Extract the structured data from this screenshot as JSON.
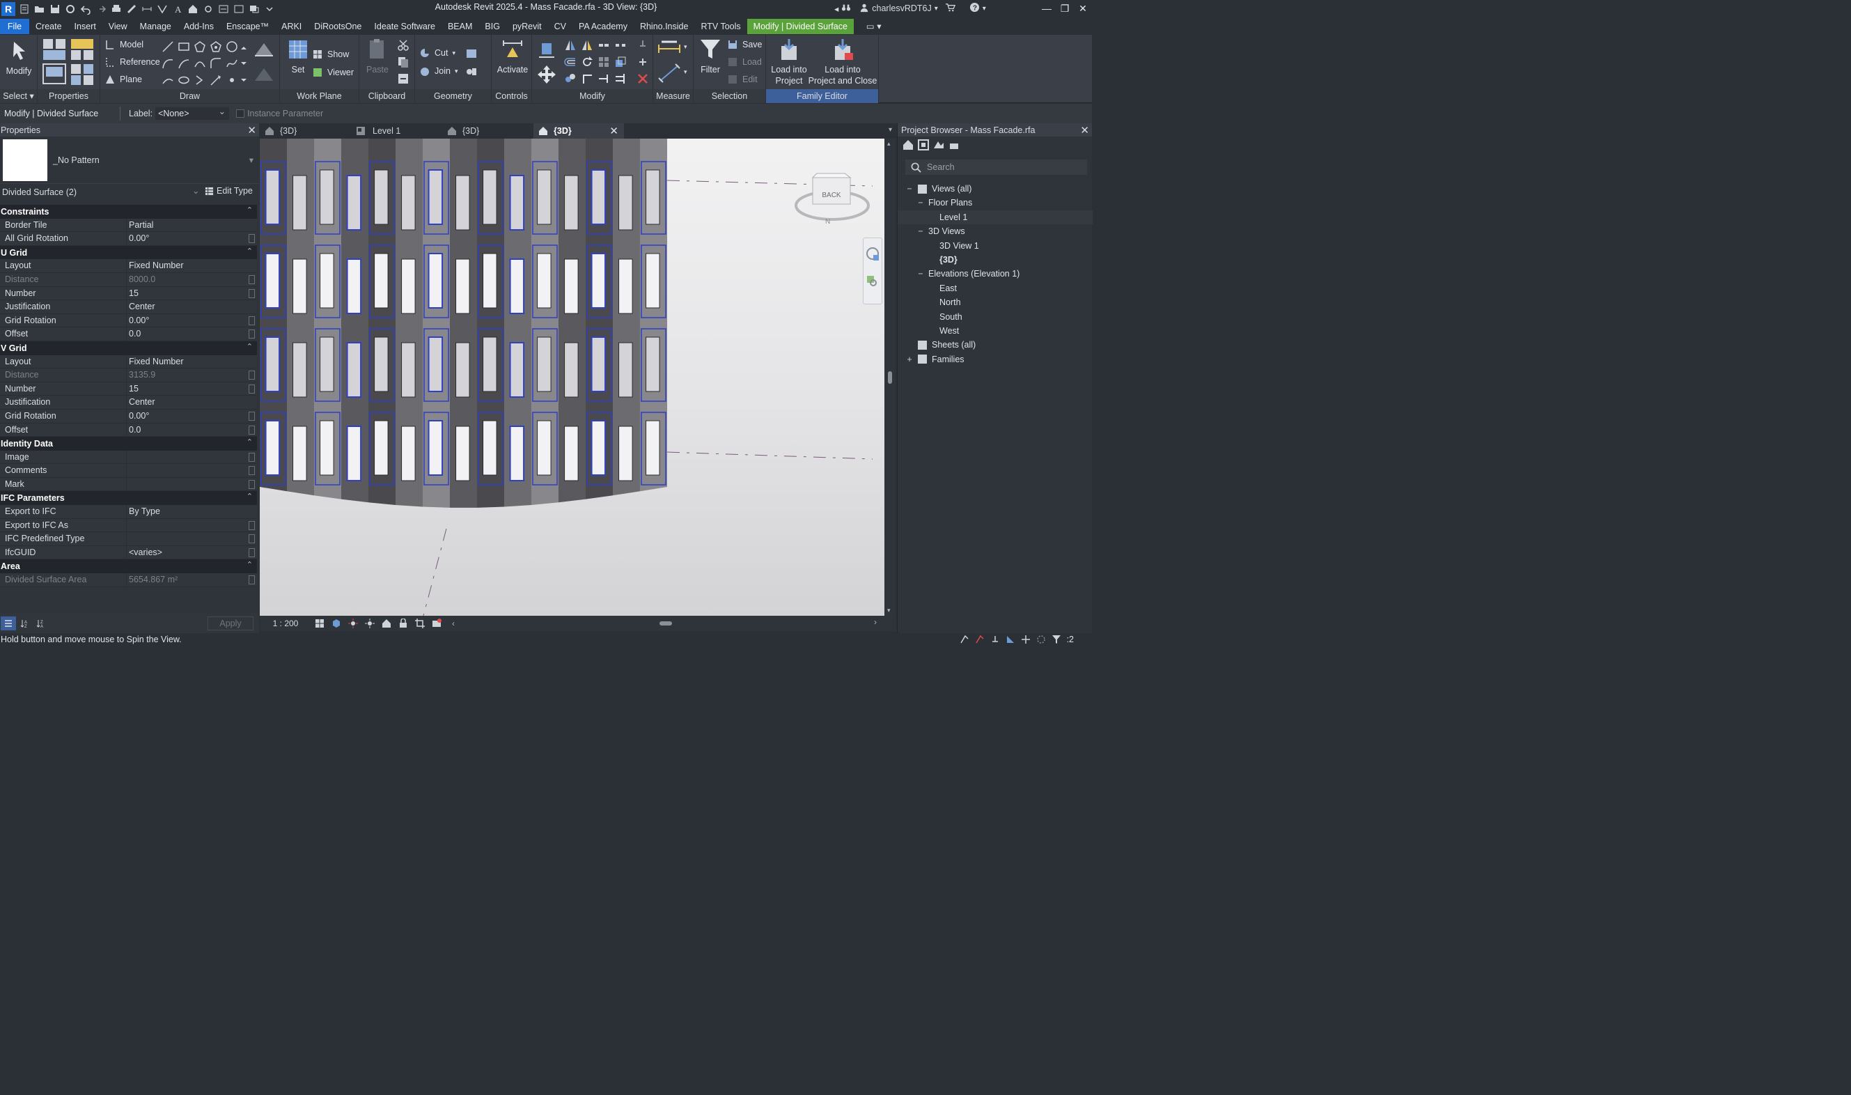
{
  "app": {
    "title": "Autodesk Revit 2025.4 - Mass Facade.rfa - 3D View: {3D}",
    "logo_letter": "R",
    "user_name": "charlesvRDT6J",
    "accent_blue": "#1f6ed4",
    "context_green": "#5aa23a"
  },
  "ribbon_tabs": [
    "File",
    "Create",
    "Insert",
    "View",
    "Manage",
    "Add-Ins",
    "Enscape™",
    "ARKI",
    "DiRootsOne",
    "Ideate Software",
    "BEAM",
    "BIG",
    "pyRevit",
    "CV",
    "PA Academy",
    "Rhino.Inside",
    "RTV Tools",
    "Modify | Divided Surface"
  ],
  "ribbon": {
    "modify_label": "Modify",
    "select_label": "Select",
    "properties_label": "Properties",
    "draw": {
      "model": "Model",
      "reference": "Reference",
      "plane": "Plane",
      "panel": "Draw"
    },
    "workplane": {
      "set": "Set",
      "show": "Show",
      "viewer": "Viewer",
      "panel": "Work Plane"
    },
    "clipboard": {
      "paste": "Paste",
      "panel": "Clipboard"
    },
    "geometry": {
      "cut": "Cut",
      "join": "Join",
      "panel": "Geometry"
    },
    "controls": {
      "activate": "Activate",
      "panel": "Controls"
    },
    "modify_panel": "Modify",
    "measure_panel": "Measure",
    "selection": {
      "filter": "Filter",
      "save": "Save",
      "load": "Load",
      "edit": "Edit",
      "panel": "Selection"
    },
    "family_editor": {
      "load_into_project": [
        "Load into",
        "Project"
      ],
      "load_close": [
        "Load into",
        "Project and Close"
      ],
      "panel": "Family Editor"
    }
  },
  "options_bar": {
    "context": "Modify | Divided Surface",
    "label_caption": "Label:",
    "label_value": "<None>",
    "instance_parameter": "Instance Parameter"
  },
  "properties": {
    "title": "Properties",
    "type_name": "_No Pattern",
    "instance_selector": "Divided Surface (2)",
    "edit_type": "Edit Type",
    "groups": [
      {
        "name": "Constraints",
        "rows": [
          {
            "name": "Border Tile",
            "value": "Partial",
            "assoc": false,
            "disabled": false
          },
          {
            "name": "All Grid Rotation",
            "value": "0.00°",
            "assoc": true,
            "disabled": false
          }
        ]
      },
      {
        "name": "U Grid",
        "rows": [
          {
            "name": "Layout",
            "value": "Fixed Number",
            "assoc": false,
            "disabled": false
          },
          {
            "name": "Distance",
            "value": "8000.0",
            "assoc": true,
            "disabled": true
          },
          {
            "name": "Number",
            "value": "15",
            "assoc": true,
            "disabled": false
          },
          {
            "name": "Justification",
            "value": "Center",
            "assoc": false,
            "disabled": false
          },
          {
            "name": "Grid Rotation",
            "value": "0.00°",
            "assoc": true,
            "disabled": false
          },
          {
            "name": "Offset",
            "value": "0.0",
            "assoc": true,
            "disabled": false
          }
        ]
      },
      {
        "name": "V Grid",
        "rows": [
          {
            "name": "Layout",
            "value": "Fixed Number",
            "assoc": false,
            "disabled": false
          },
          {
            "name": "Distance",
            "value": "3135.9",
            "assoc": true,
            "disabled": true
          },
          {
            "name": "Number",
            "value": "15",
            "assoc": true,
            "disabled": false
          },
          {
            "name": "Justification",
            "value": "Center",
            "assoc": false,
            "disabled": false
          },
          {
            "name": "Grid Rotation",
            "value": "0.00°",
            "assoc": true,
            "disabled": false
          },
          {
            "name": "Offset",
            "value": "0.0",
            "assoc": true,
            "disabled": false
          }
        ]
      },
      {
        "name": "Identity Data",
        "rows": [
          {
            "name": "Image",
            "value": "",
            "assoc": true,
            "disabled": false
          },
          {
            "name": "Comments",
            "value": "",
            "assoc": true,
            "disabled": false
          },
          {
            "name": "Mark",
            "value": "",
            "assoc": true,
            "disabled": false
          }
        ]
      },
      {
        "name": "IFC Parameters",
        "rows": [
          {
            "name": "Export to IFC",
            "value": "By Type",
            "assoc": false,
            "disabled": false
          },
          {
            "name": "Export to IFC As",
            "value": "",
            "assoc": true,
            "disabled": false
          },
          {
            "name": "IFC Predefined Type",
            "value": "",
            "assoc": true,
            "disabled": false
          },
          {
            "name": "IfcGUID",
            "value": "<varies>",
            "assoc": true,
            "disabled": false
          }
        ]
      },
      {
        "name": "Area",
        "rows": [
          {
            "name": "Divided Surface Area",
            "value": "5654.867 m²",
            "assoc": true,
            "disabled": true
          }
        ]
      }
    ],
    "apply": "Apply"
  },
  "view_tabs": [
    {
      "label": "{3D}",
      "icon": "home-icon",
      "active": false
    },
    {
      "label": "Level 1",
      "icon": "floor-plan-icon",
      "active": false
    },
    {
      "label": "{3D}",
      "icon": "home-icon",
      "active": false
    },
    {
      "label": "{3D}",
      "icon": "home-icon",
      "active": true
    }
  ],
  "viewport": {
    "viewcube_face": "BACK",
    "viewcube_compass": "N",
    "scale": "1 : 200"
  },
  "project_browser": {
    "title": "Project Browser - Mass Facade.rfa",
    "search_placeholder": "Search",
    "tree": [
      {
        "label": "Views (all)",
        "level": 0,
        "toggle": "−",
        "icon": true,
        "bold": false,
        "selected": false
      },
      {
        "label": "Floor Plans",
        "level": 1,
        "toggle": "−",
        "icon": false,
        "bold": false,
        "selected": false
      },
      {
        "label": "Level 1",
        "level": 2,
        "toggle": "",
        "icon": false,
        "bold": false,
        "selected": true
      },
      {
        "label": "3D Views",
        "level": 1,
        "toggle": "−",
        "icon": false,
        "bold": false,
        "selected": false
      },
      {
        "label": "3D View 1",
        "level": 2,
        "toggle": "",
        "icon": false,
        "bold": false,
        "selected": false
      },
      {
        "label": "{3D}",
        "level": 2,
        "toggle": "",
        "icon": false,
        "bold": true,
        "selected": false
      },
      {
        "label": "Elevations (Elevation 1)",
        "level": 1,
        "toggle": "−",
        "icon": false,
        "bold": false,
        "selected": false
      },
      {
        "label": "East",
        "level": 2,
        "toggle": "",
        "icon": false,
        "bold": false,
        "selected": false
      },
      {
        "label": "North",
        "level": 2,
        "toggle": "",
        "icon": false,
        "bold": false,
        "selected": false
      },
      {
        "label": "South",
        "level": 2,
        "toggle": "",
        "icon": false,
        "bold": false,
        "selected": false
      },
      {
        "label": "West",
        "level": 2,
        "toggle": "",
        "icon": false,
        "bold": false,
        "selected": false
      },
      {
        "label": "Sheets (all)",
        "level": 0,
        "toggle": "",
        "icon": true,
        "bold": false,
        "selected": false
      },
      {
        "label": "Families",
        "level": 0,
        "toggle": "+",
        "icon": true,
        "bold": false,
        "selected": false
      }
    ]
  },
  "status": {
    "text": "Hold button and move mouse to Spin the View.",
    "filter_count": ":2"
  }
}
